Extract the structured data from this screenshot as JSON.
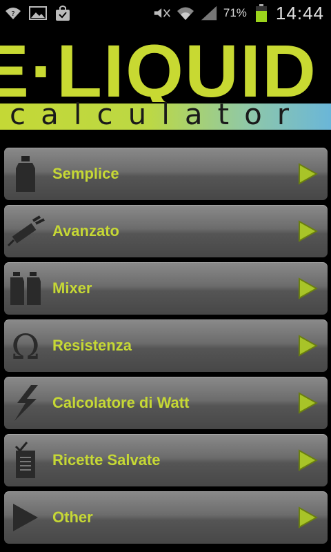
{
  "status_bar": {
    "battery_percent": "71%",
    "time": "14:44",
    "icons": [
      "wifi-icon",
      "gallery-icon",
      "shopping-bag-icon",
      "mute-icon",
      "wifi-signal-icon",
      "cell-signal-icon",
      "battery-icon"
    ]
  },
  "logo": {
    "title": "E·LIQUID",
    "subtitle": "calculator"
  },
  "colors": {
    "accent": "#c6d835",
    "button_top": "#8a8a8a",
    "button_bottom": "#474747"
  },
  "menu": {
    "items": [
      {
        "label": "Semplice",
        "icon": "bottle-icon"
      },
      {
        "label": "Avanzato",
        "icon": "syringe-icon"
      },
      {
        "label": "Mixer",
        "icon": "two-bottles-icon"
      },
      {
        "label": "Resistenza",
        "icon": "omega-icon"
      },
      {
        "label": "Calcolatore di Watt",
        "icon": "lightning-icon"
      },
      {
        "label": "Ricette Salvate",
        "icon": "clipboard-icon"
      },
      {
        "label": "Other",
        "icon": "play-icon"
      }
    ]
  }
}
